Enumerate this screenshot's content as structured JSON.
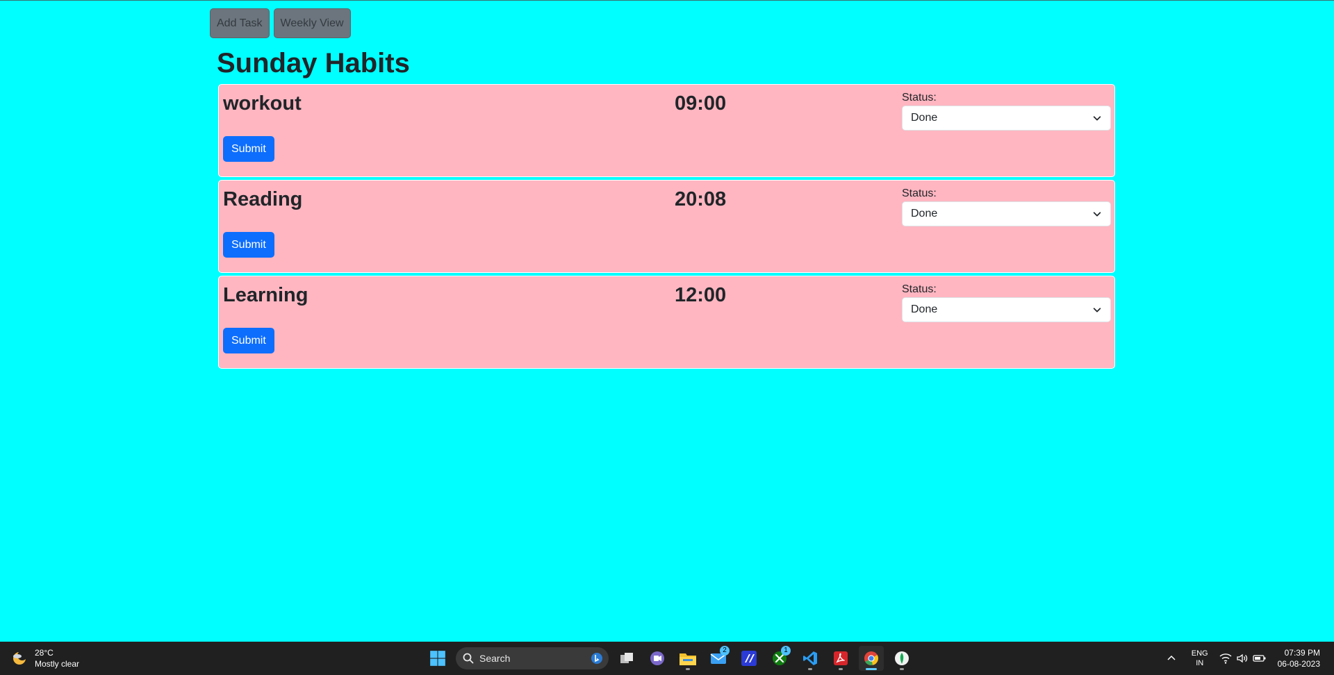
{
  "nav": {
    "add_task": "Add Task",
    "weekly_view": "Weekly View"
  },
  "page": {
    "title": "Sunday Habits"
  },
  "tasks": [
    {
      "name": "workout",
      "time": "09:00",
      "status_label": "Status:",
      "status": "Done",
      "submit": "Submit"
    },
    {
      "name": "Reading",
      "time": "20:08",
      "status_label": "Status:",
      "status": "Done",
      "submit": "Submit"
    },
    {
      "name": "Learning",
      "time": "12:00",
      "status_label": "Status:",
      "status": "Done",
      "submit": "Submit"
    }
  ],
  "colors": {
    "background": "#00ffff",
    "card": "#ffb6c1",
    "primary_button": "#0d6efd",
    "secondary_button": "#6c757d"
  },
  "taskbar": {
    "weather_temp": "28°C",
    "weather_desc": "Mostly clear",
    "search_placeholder": "Search",
    "mail_badge": "2",
    "xbox_badge": "1",
    "lang_primary": "ENG",
    "lang_secondary": "IN",
    "time": "07:39 PM",
    "date": "06-08-2023",
    "icons": [
      "start-icon",
      "search-icon",
      "task-view-icon",
      "teams-icon",
      "file-explorer-icon",
      "mail-icon",
      "app-icon",
      "xbox-icon",
      "vscode-icon",
      "acrobat-icon",
      "chrome-icon",
      "mongodb-icon"
    ]
  }
}
